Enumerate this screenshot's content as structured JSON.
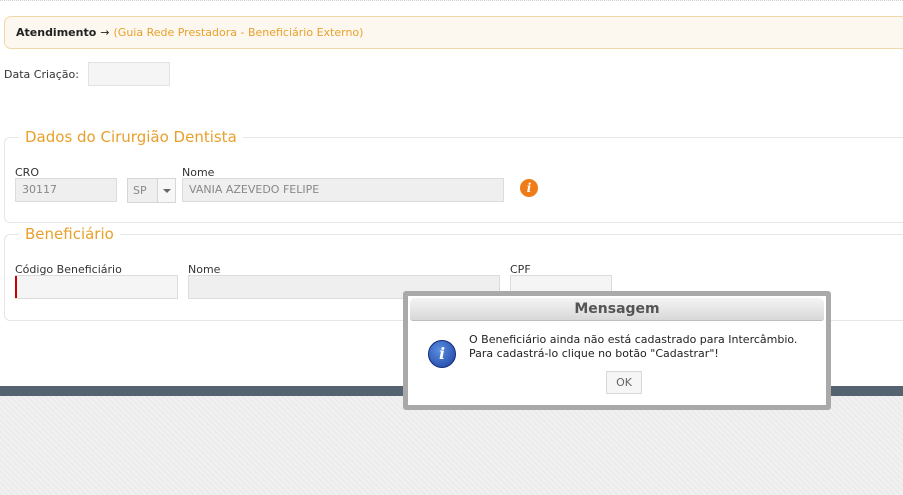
{
  "breadcrumb": {
    "root": "Atendimento",
    "arrow": "→",
    "current": "(Guia Rede Prestadora - Beneficiário Externo)"
  },
  "form": {
    "data_criacao_label": "Data Criação:",
    "data_criacao_value": ""
  },
  "dentista": {
    "legend": "Dados do Cirurgião Dentista",
    "cro_label": "CRO",
    "cro_value": "30117",
    "uf_value": "SP",
    "nome_label": "Nome",
    "nome_value": "VANIA AZEVEDO FELIPE",
    "info_icon": "info-orange-icon"
  },
  "beneficiario": {
    "legend": "Beneficiário",
    "codigo_label": "Código Beneficiário",
    "codigo_value": "",
    "nome_label": "Nome",
    "nome_value": "",
    "cpf_label": "CPF",
    "cpf_value": ""
  },
  "modal": {
    "title": "Mensagem",
    "line1": "O Beneficiário ainda não está cadastrado para Intercâmbio.",
    "line2": "Para cadastrá-lo clique no botão \"Cadastrar\"!",
    "ok_label": "OK",
    "icon": "info-blue-icon"
  },
  "colors": {
    "accent": "#e8a02b",
    "footer_bar": "#556370",
    "info_orange": "#f07c17",
    "info_blue": "#1a3fa0"
  }
}
